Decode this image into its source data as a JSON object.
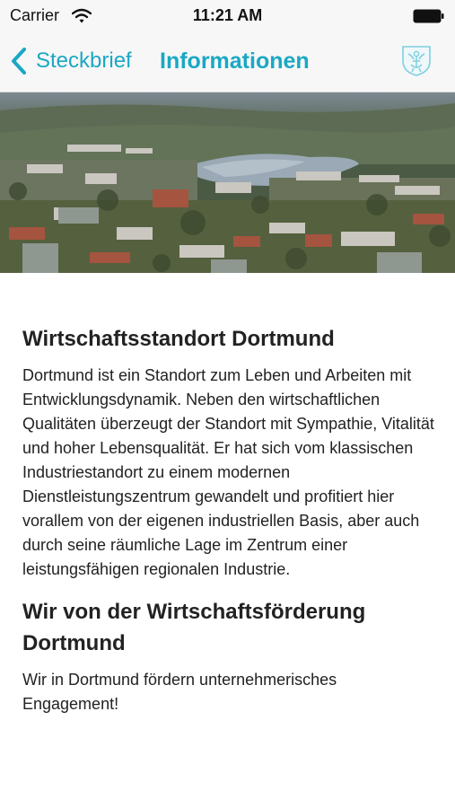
{
  "status_bar": {
    "carrier": "Carrier",
    "time": "11:21 AM"
  },
  "nav": {
    "back_label": "Steckbrief",
    "title": "Informationen"
  },
  "colors": {
    "accent": "#1aa8c4",
    "nav_background": "#f7f7f7"
  },
  "icons": {
    "back": "chevron-left-icon",
    "logo": "coat-of-arms-icon",
    "wifi": "wifi-icon",
    "battery": "battery-icon"
  },
  "sections": [
    {
      "heading": "Wirtschaftsstandort Dortmund",
      "text": "Dortmund ist ein Standort zum Leben und Arbeiten mit Entwicklungsdynamik. Neben den wirtschaftlichen Qualitäten überzeugt der Standort mit Sympathie, Vitalität und hoher Lebensqualität. Er hat sich vom klassischen Industriestandort zu einem modernen Dienstleistungszentrum gewandelt und profitiert hier vorallem von der eigenen industriellen Basis, aber auch durch seine räumliche Lage im Zentrum einer leistungsfähigen regionalen Industrie."
    },
    {
      "heading": "Wir von der Wirtschaftsförderung Dortmund",
      "text": "Wir in Dortmund fördern unternehmerisches Engagement!"
    }
  ]
}
